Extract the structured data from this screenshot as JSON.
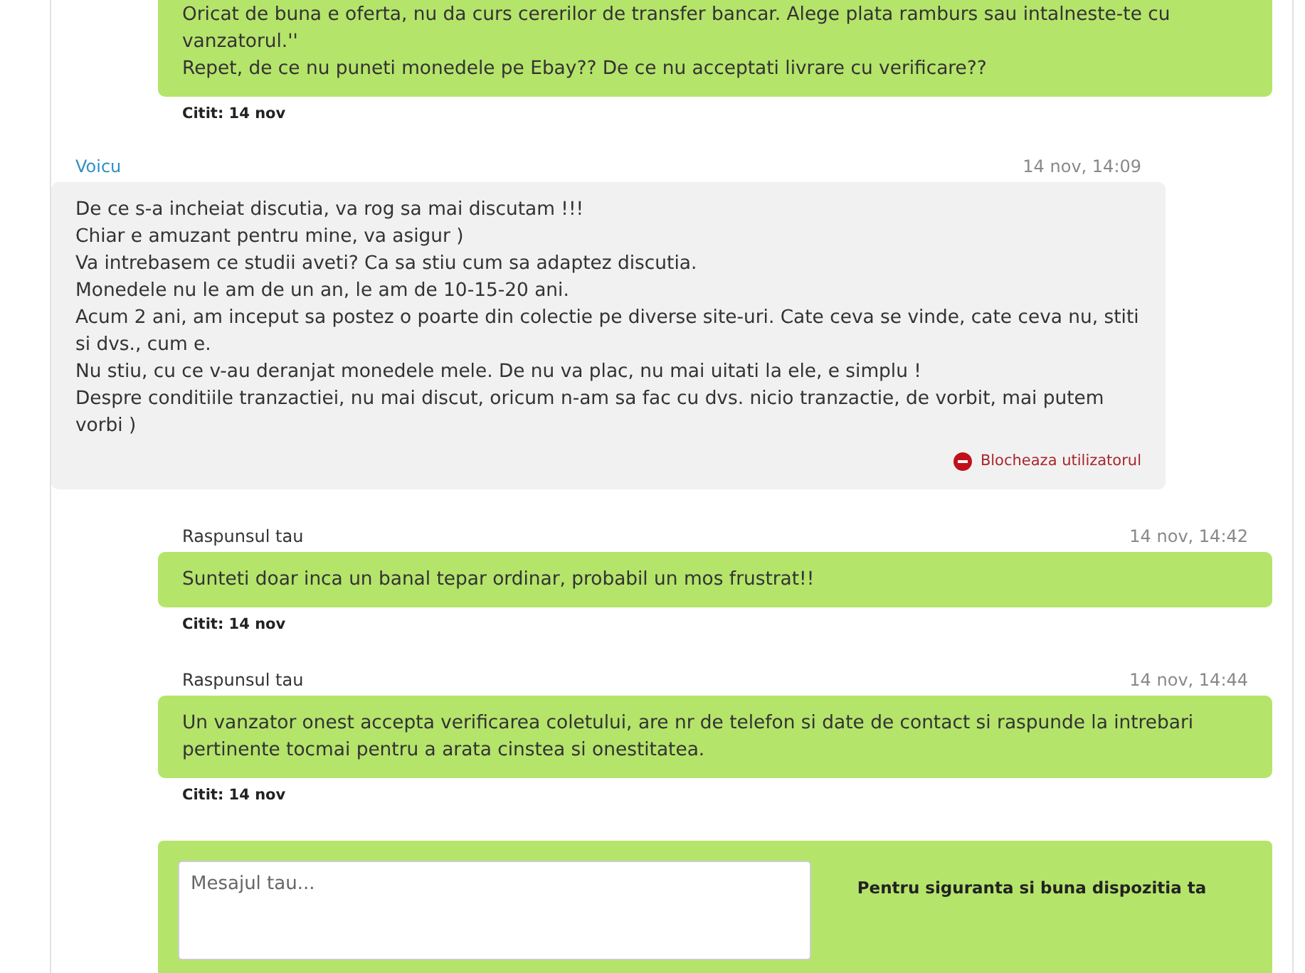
{
  "messages": [
    {
      "kind": "mine",
      "text": "Oricat de buna e oferta, nu da curs cererilor de transfer bancar. Alege plata ramburs sau intalneste-te cu vanzatorul.''\nRepet, de ce nu puneti monedele pe Ebay?? De ce nu acceptati livrare cu verificare??",
      "read": "Citit: 14 nov"
    },
    {
      "kind": "theirs",
      "author": "Voicu",
      "time": "14 nov, 14:09",
      "text": "De ce s-a incheiat discutia, va rog sa mai discutam !!!\nChiar e amuzant pentru mine, va asigur )\nVa intrebasem ce studii aveti? Ca sa stiu cum sa adaptez discutia.\nMonedele nu le am de un an, le am de 10-15-20 ani.\nAcum 2 ani, am inceput sa postez o poarte din colectie pe diverse site-uri. Cate ceva se vinde, cate ceva nu, stiti si dvs., cum e.\nNu stiu, cu ce v-au deranjat monedele mele. De nu va plac, nu mai uitati la ele, e simplu !\nDespre conditiile tranzactiei, nu mai discut, oricum n-am sa fac cu dvs. nicio tranzactie, de vorbit, mai putem vorbi )",
      "action": "Blocheaza utilizatorul"
    },
    {
      "kind": "mine",
      "author": "Raspunsul tau",
      "time": "14 nov, 14:42",
      "text": "Sunteti doar inca un banal tepar ordinar, probabil un mos frustrat!!",
      "read": "Citit: 14 nov"
    },
    {
      "kind": "mine",
      "author": "Raspunsul tau",
      "time": "14 nov, 14:44",
      "text": "Un vanzator onest accepta verificarea coletului, are nr de telefon si date de contact si raspunde la intrebari pertinente tocmai pentru a arata cinstea si onestitatea.",
      "read": "Citit: 14 nov"
    }
  ],
  "composer": {
    "placeholder": "Mesajul tau...",
    "note": "Pentru siguranta si buna dispozitia ta"
  }
}
